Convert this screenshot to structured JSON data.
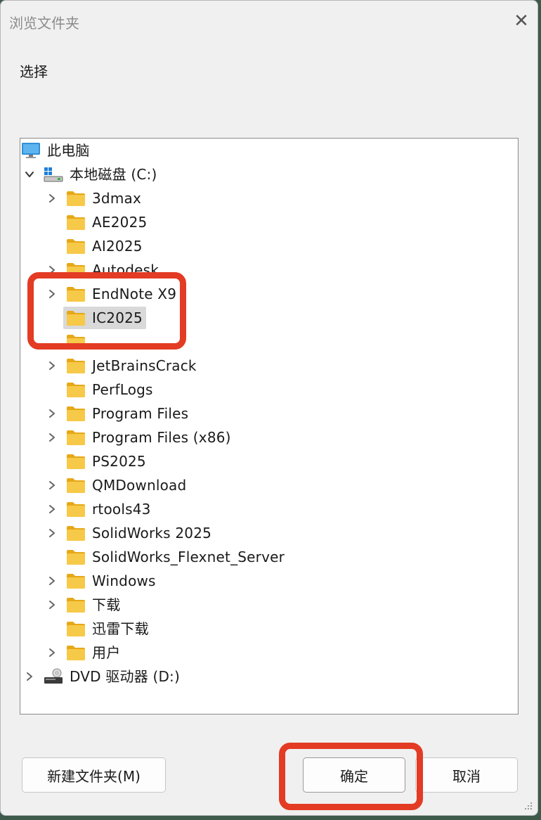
{
  "window": {
    "title": "浏览文件夹",
    "close_glyph": "✕"
  },
  "prompt": "选择",
  "tree": {
    "root": {
      "label": "此电脑",
      "icon": "computer-icon"
    },
    "drive_c": {
      "label": "本地磁盘 (C:)",
      "icon": "drive-icon",
      "expanded": true
    },
    "folders": [
      {
        "label": "3dmax",
        "has_children": true
      },
      {
        "label": "AE2025",
        "has_children": false
      },
      {
        "label": "AI2025",
        "has_children": false
      },
      {
        "label": "Autodesk",
        "has_children": true
      },
      {
        "label": "EndNote X9",
        "has_children": true
      },
      {
        "label": "IC2025",
        "has_children": false,
        "selected": true
      },
      {
        "label": "",
        "has_children": false
      },
      {
        "label": "JetBrainsCrack",
        "has_children": true
      },
      {
        "label": "PerfLogs",
        "has_children": false
      },
      {
        "label": "Program Files",
        "has_children": true
      },
      {
        "label": "Program Files (x86)",
        "has_children": true
      },
      {
        "label": "PS2025",
        "has_children": false
      },
      {
        "label": "QMDownload",
        "has_children": true
      },
      {
        "label": "rtools43",
        "has_children": true
      },
      {
        "label": "SolidWorks 2025",
        "has_children": true
      },
      {
        "label": "SolidWorks_Flexnet_Server",
        "has_children": false
      },
      {
        "label": "Windows",
        "has_children": true
      },
      {
        "label": "下载",
        "has_children": true
      },
      {
        "label": "迅雷下载",
        "has_children": false
      },
      {
        "label": "用户",
        "has_children": true
      }
    ],
    "drive_d": {
      "label": "DVD 驱动器 (D:)",
      "icon": "dvd-drive-icon",
      "expanded": false
    }
  },
  "buttons": {
    "new_folder": "新建文件夹(M)",
    "ok": "确定",
    "cancel": "取消"
  },
  "colors": {
    "folder": "#f7c948",
    "highlight": "#e33b24",
    "selection": "#d9d9d9"
  }
}
